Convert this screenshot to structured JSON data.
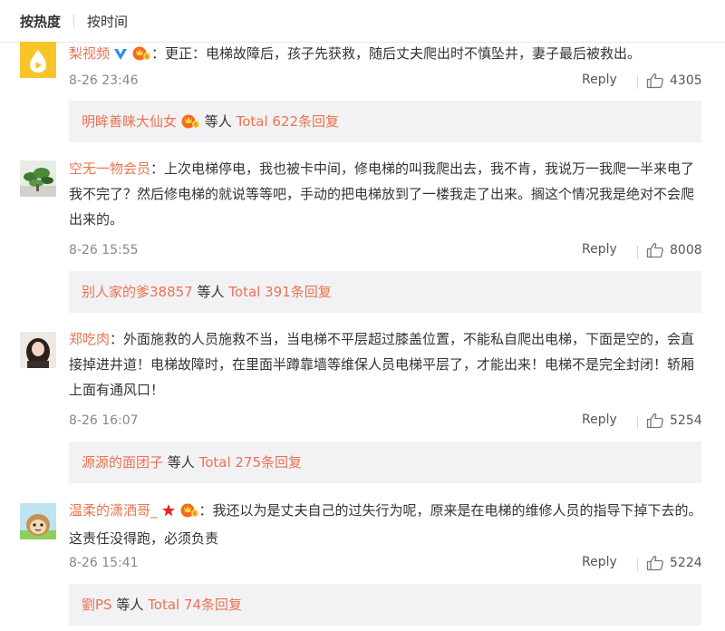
{
  "sort_tabs": {
    "hot": "按热度",
    "time": "按时间"
  },
  "comments": [
    {
      "user": "梨视频",
      "text": "：更正：电梯故障后，孩子先获救，随后丈夫爬出时不慎坠井，妻子最后被救出。",
      "time": "8-26 23:46",
      "reply": "Reply",
      "likes": "4305",
      "sub": {
        "user": "明眸善睐大仙女",
        "others": "等人",
        "total": "Total 622条回复"
      }
    },
    {
      "user": "空无一物会员",
      "text": "：上次电梯停电，我也被卡中间，修电梯的叫我爬出去，我不肯，我说万一我爬一半来电了我不完了？然后修电梯的就说等等吧，手动的把电梯放到了一楼我走了出来。搁这个情况我是绝对不会爬出来的。",
      "time": "8-26 15:55",
      "reply": "Reply",
      "likes": "8008",
      "sub": {
        "user": "别人家的爹38857",
        "others": "等人",
        "total": "Total 391条回复"
      }
    },
    {
      "user": "郑吃肉",
      "text": "：外面施救的人员施救不当，当电梯不平层超过膝盖位置，不能私自爬出电梯，下面是空的，会直接掉进井道！电梯故障时，在里面半蹲靠墙等维保人员电梯平层了，才能出来！电梯不是完全封闭！轿厢上面有通风口！",
      "time": "8-26 16:07",
      "reply": "Reply",
      "likes": "5254",
      "sub": {
        "user": "源源的面团子",
        "others": "等人",
        "total": "Total 275条回复"
      }
    },
    {
      "user": "温柔的潇洒哥_",
      "text": "：我还以为是丈夫自己的过失行为呢，原来是在电梯的维修人员的指导下掉下去的。这责任没得跑，必须负责",
      "time": "8-26 15:41",
      "reply": "Reply",
      "likes": "5224",
      "sub": {
        "user": "劉PS",
        "others": "等人",
        "total": "Total 74条回复"
      }
    }
  ],
  "colors": {
    "username": "#eb7350",
    "sub_bg": "#f2f2f5",
    "vip": "#f36b1c",
    "verified": "#2d8ef3"
  }
}
